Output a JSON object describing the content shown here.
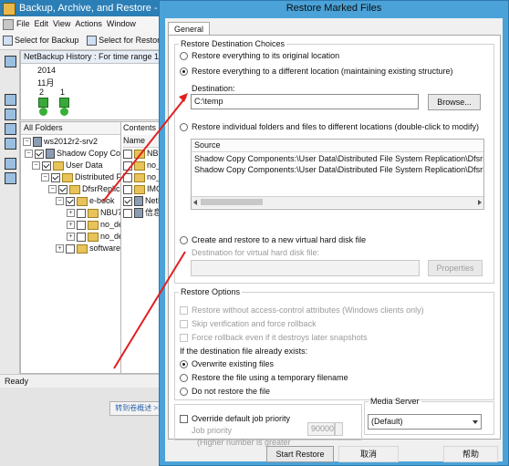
{
  "bg": {
    "title": "Backup, Archive, and Restore - Ne",
    "menu": [
      "File",
      "Edit",
      "View",
      "Actions",
      "Window"
    ],
    "toolbar": {
      "select_backup": "Select for Backup",
      "select_restore": "Select for Restor"
    },
    "history": {
      "header": "NetBackup History : For time range 197",
      "year": "2014",
      "month": "11月",
      "days": [
        "2",
        "1"
      ]
    },
    "folders": {
      "header": "All Folders",
      "items": [
        "ws2012r2-srv2",
        "Shadow Copy Compor",
        "User Data",
        "Distributed File",
        "DfsrReplicate",
        "e-book",
        "NBU7",
        "no_de",
        "no_de",
        "software"
      ]
    },
    "contents": {
      "header": "Contents o",
      "col": "Name",
      "items": [
        "NBU",
        "no_d",
        "no_d",
        "IMG_",
        "NetB",
        "信息"
      ]
    },
    "status": "Ready",
    "jump_button": "转到卷概述 >>"
  },
  "dialog": {
    "title": "Restore Marked Files",
    "tab": "General",
    "dest": {
      "legend": "Restore Destination Choices",
      "opt_original": "Restore everything to its original location",
      "opt_different": "Restore everything to a different location (maintaining existing structure)",
      "destination_label": "Destination:",
      "destination_value": "C:\\temp",
      "browse": "Browse...",
      "opt_individual": "Restore individual folders and files to different locations (double-click to modify)",
      "source_header": "Source",
      "sources": [
        "Shadow Copy Components:\\User Data\\Distributed File System Replication\\DfsrRep",
        "Shadow Copy Components:\\User Data\\Distributed File System Replication\\DfsrRep"
      ],
      "opt_vhd": "Create and restore to a new virtual hard disk file",
      "vhd_label": "Destination for virtual hard disk file:",
      "properties": "Properties"
    },
    "options": {
      "legend": "Restore Options",
      "acl": "Restore without access-control attributes (Windows clients only)",
      "skip_verify": "Skip verification and force rollback",
      "force_rollback": "Force rollback even if it destroys later snapshots",
      "exists_label": "If the destination file already exists:",
      "overwrite": "Overwrite existing files",
      "temp_name": "Restore the file using a temporary filename",
      "do_not": "Do not restore the file"
    },
    "priority": {
      "override": "Override default job priority",
      "job_priority": "Job priority",
      "value": "90000",
      "hint": "(Higher number is greater"
    },
    "media": {
      "legend": "Media Server",
      "value": "(Default)"
    },
    "buttons": {
      "start": "Start Restore",
      "cancel": "取消",
      "help": "帮助"
    }
  }
}
